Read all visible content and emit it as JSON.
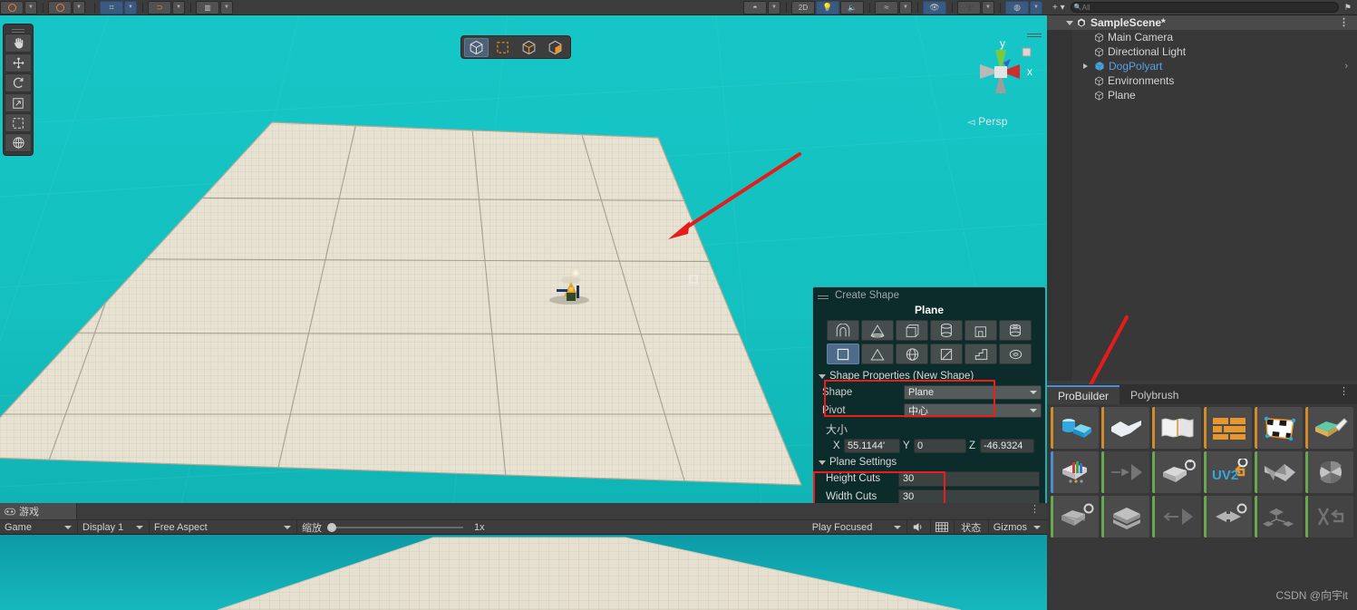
{
  "window": {
    "accent_blue": "#4a8fd4",
    "annotation_red": "#ef1c1c",
    "scene_bg": "#17c4c4",
    "plane_color": "#e8e2d3"
  },
  "top_toolbar": {
    "buttons": [
      {
        "name": "pivot-rotation-toggle",
        "label": ""
      },
      {
        "name": "pivot-center-toggle",
        "label": ""
      },
      {
        "name": "grid-snap-toggle",
        "label": ""
      },
      {
        "name": "snap-increment",
        "label": ""
      },
      {
        "name": "scene-ruler",
        "label": ""
      }
    ],
    "right_buttons": [
      {
        "name": "shaded-mode",
        "label": ""
      },
      {
        "name": "2d-toggle",
        "label": "2D"
      },
      {
        "name": "lighting-toggle",
        "label": ""
      },
      {
        "name": "audio-toggle",
        "label": ""
      },
      {
        "name": "fx-toggle",
        "label": ""
      },
      {
        "name": "scene-visibility",
        "label": ""
      },
      {
        "name": "camera-settings",
        "label": ""
      },
      {
        "name": "gizmos-toggle",
        "label": ""
      }
    ]
  },
  "hierarchy": {
    "search_placeholder": "All",
    "root": {
      "label": "SampleScene*",
      "expanded": true
    },
    "items": [
      {
        "label": "Main Camera",
        "selected": false,
        "expandable": false
      },
      {
        "label": "Directional Light",
        "selected": false,
        "expandable": false
      },
      {
        "label": "DogPolyart",
        "selected": true,
        "expandable": true
      },
      {
        "label": "Environments",
        "selected": false,
        "expandable": false
      },
      {
        "label": "Plane",
        "selected": false,
        "expandable": false
      }
    ]
  },
  "scene_view": {
    "left_tools": [
      {
        "name": "view-tool-hand",
        "glyph": "hand"
      },
      {
        "name": "move-tool",
        "glyph": "move"
      },
      {
        "name": "rotate-tool",
        "glyph": "rotate"
      },
      {
        "name": "scale-tool",
        "glyph": "scale"
      },
      {
        "name": "rect-tool",
        "glyph": "rect"
      },
      {
        "name": "transform-tool",
        "glyph": "transform"
      }
    ],
    "element_modes": [
      {
        "name": "object-mode",
        "selected": true
      },
      {
        "name": "vertex-mode",
        "selected": false
      },
      {
        "name": "edge-mode",
        "selected": false
      },
      {
        "name": "face-mode",
        "selected": false
      }
    ],
    "gizmo": {
      "perspective_label": "Persp",
      "axis_x": "x",
      "axis_y": "y"
    }
  },
  "create_shape": {
    "panel_title": "Create Shape",
    "shape_title": "Plane",
    "shape_icons_row1": [
      {
        "name": "arch-shape-icon",
        "selected": false
      },
      {
        "name": "cone-shape-icon",
        "selected": false
      },
      {
        "name": "cube-shape-icon",
        "selected": false
      },
      {
        "name": "cylinder-shape-icon",
        "selected": false
      },
      {
        "name": "door-shape-icon",
        "selected": false
      },
      {
        "name": "pipe-shape-icon",
        "selected": false
      }
    ],
    "shape_icons_row2": [
      {
        "name": "plane-shape-icon",
        "selected": true
      },
      {
        "name": "prism-shape-icon",
        "selected": false
      },
      {
        "name": "sphere-shape-icon",
        "selected": false
      },
      {
        "name": "sprite-shape-icon",
        "selected": false
      },
      {
        "name": "stair-shape-icon",
        "selected": false
      },
      {
        "name": "torus-shape-icon",
        "selected": false
      }
    ],
    "properties_header": "Shape Properties (New Shape)",
    "shape_label": "Shape",
    "shape_value": "Plane",
    "pivot_label": "Pivot",
    "pivot_value": "中心",
    "size_label": "大小",
    "size": {
      "x_axis": "X",
      "x_value": "55.1144'",
      "y_axis": "Y",
      "y_value": "0",
      "z_axis": "Z",
      "z_value": "-46.9324"
    },
    "plane_settings_header": "Plane Settings",
    "height_cuts_label": "Height Cuts",
    "height_cuts_value": "30",
    "width_cuts_label": "Width Cuts",
    "width_cuts_value": "30"
  },
  "game_view": {
    "tab_label": "游戏",
    "target_display_label": "Game",
    "display_label": "Display 1",
    "aspect_label": "Free Aspect",
    "scale_label": "缩放",
    "scale_value": "1x",
    "play_mode_label": "Play Focused",
    "mute_audio_name": "mute-audio-icon",
    "grid_name": "grid-icon",
    "stats_label": "状态",
    "gizmos_label": "Gizmos"
  },
  "probuilder": {
    "tabs": [
      {
        "label": "ProBuilder",
        "active": true
      },
      {
        "label": "Polybrush",
        "active": false
      }
    ],
    "tools_row1": [
      {
        "name": "new-shape-tool",
        "color": "#d08b2a"
      },
      {
        "name": "new-poly-shape-tool",
        "color": "#d08b2a"
      },
      {
        "name": "new-bezier-shape-tool",
        "color": "#d08b2a"
      },
      {
        "name": "material-editor-tool",
        "color": "#d08b2a"
      },
      {
        "name": "uv-editor-tool",
        "color": "#d08b2a"
      },
      {
        "name": "vertex-colors-tool",
        "color": "#d08b2a"
      }
    ],
    "tools_row2": [
      {
        "name": "smoothing-groups-tool",
        "color": "#4a8fd4"
      },
      {
        "name": "mirror-objects-tool",
        "color": "#6aa84f"
      },
      {
        "name": "merge-objects-tool",
        "color": "#6aa84f"
      },
      {
        "name": "lightmap-uvs-tool",
        "color": "#6aa84f"
      },
      {
        "name": "flip-normals-tool",
        "color": "#6aa84f"
      },
      {
        "name": "subdivide-object-tool",
        "color": "#6aa84f"
      }
    ],
    "tools_row3": [
      {
        "name": "triangulate-tool",
        "color": "#6aa84f"
      },
      {
        "name": "center-pivot-tool",
        "color": "#6aa84f"
      },
      {
        "name": "conform-normals-tool",
        "color": "#6aa84f"
      },
      {
        "name": "export-tool",
        "color": "#6aa84f"
      },
      {
        "name": "set-collider-tool",
        "color": "#6aa84f"
      },
      {
        "name": "set-trigger-tool",
        "color": "#6aa84f"
      }
    ]
  },
  "watermark": {
    "text": "CSDN @向宇it"
  }
}
